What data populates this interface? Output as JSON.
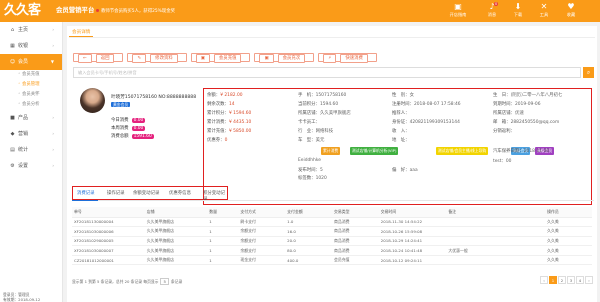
{
  "header": {
    "logo": "久久客",
    "brand": "会员营销平台",
    "notice": "教师节会员购买5人，获得25%现金奖",
    "nav": [
      {
        "label": "开店指南",
        "icon": "store-icon",
        "glyph": "▣"
      },
      {
        "label": "消息",
        "icon": "bell-icon",
        "glyph": "♪",
        "badge": "0"
      },
      {
        "label": "下载",
        "icon": "download-icon",
        "glyph": "⬇"
      },
      {
        "label": "工具",
        "icon": "tools-icon",
        "glyph": "✕"
      },
      {
        "label": "收藏",
        "icon": "heart-icon",
        "glyph": "♥"
      }
    ]
  },
  "sidebar": {
    "items": [
      {
        "label": "主页",
        "icon": "home-icon",
        "glyph": "⌂"
      },
      {
        "label": "收银",
        "icon": "cashier-icon",
        "glyph": "▦"
      },
      {
        "label": "会员",
        "icon": "member-icon",
        "glyph": "☺",
        "active": true
      }
    ],
    "subs": [
      {
        "label": "会员充值"
      },
      {
        "label": "会员管理",
        "current": true
      },
      {
        "label": "会员关怀"
      },
      {
        "label": "会员分析"
      }
    ],
    "items2": [
      {
        "label": "产品",
        "icon": "product-icon",
        "glyph": "■"
      },
      {
        "label": "营销",
        "icon": "marketing-icon",
        "glyph": "◆"
      },
      {
        "label": "统计",
        "icon": "stats-icon",
        "glyph": "▤"
      },
      {
        "label": "设置",
        "icon": "settings-icon",
        "glyph": "⚙"
      }
    ],
    "footer": {
      "user": "登录员：管理员",
      "date": "有效期：2018-09-12"
    }
  },
  "page_tab": "会员详情",
  "actions": [
    {
      "label": "返回",
      "icon": "back-icon",
      "glyph": "←"
    },
    {
      "label": "修改资料",
      "icon": "edit-icon",
      "glyph": "✎"
    },
    {
      "label": "会员充值",
      "icon": "recharge-icon",
      "glyph": "▣"
    },
    {
      "label": "会员充次",
      "icon": "recharge-count-icon",
      "glyph": "▣"
    },
    {
      "label": "快速消费",
      "icon": "quick-pay-icon",
      "glyph": "⚡"
    }
  ],
  "search": {
    "placeholder": "输入会员卡号/手机号/姓名/拼音"
  },
  "member": {
    "name": "叶晓芳15071758160",
    "no": "NO:8888888888",
    "level": "黄金会员",
    "stats": [
      {
        "label": "今日消费",
        "value": "0.00"
      },
      {
        "label": "本周消费",
        "value": "0.00"
      },
      {
        "label": "消费总额",
        "value": "1591.60"
      }
    ]
  },
  "info": [
    {
      "label": "余额：",
      "value": "¥ 2182.00",
      "red": true
    },
    {
      "label": "手　机：",
      "value": "15071758160"
    },
    {
      "label": "性　别：",
      "value": "女"
    },
    {
      "label": "生　日：",
      "value": "(阴历)二零一八年八月初七"
    },
    {
      "label": "剩余次数：",
      "value": "14",
      "red": true
    },
    {
      "label": "当前积分：",
      "value": "1594.60"
    },
    {
      "label": "注册时间：",
      "value": "2018-08-07 17:58:46"
    },
    {
      "label": "到期时间：",
      "value": "2019-09-06"
    },
    {
      "label": "累计积分：",
      "value": "¥ 1594.60",
      "red": true
    },
    {
      "label": "所属店铺：",
      "value": "久久美甲旗舰店"
    },
    {
      "label": "推荐人：",
      "value": ""
    },
    {
      "label": "所属店铺：",
      "value": "优速"
    },
    {
      "label": "累计消费：",
      "value": "¥ 4435.10",
      "red": true
    },
    {
      "label": "卡卡员工：",
      "value": ""
    },
    {
      "label": "身份证：",
      "value": "420821199309153144"
    },
    {
      "label": "邮　箱：",
      "value": "2882450550@qq.com"
    },
    {
      "label": "累计充值：",
      "value": "¥ 5850.00",
      "red": true
    },
    {
      "label": "行　业：",
      "value": "网络科技"
    },
    {
      "label": "收　入：",
      "value": ""
    },
    {
      "label": "分销返利：",
      "value": ""
    },
    {
      "label": "优惠券：",
      "value": "0",
      "red": true
    },
    {
      "label": "车　型：",
      "value": "美元"
    },
    {
      "label": "地　址：",
      "value": ""
    },
    {
      "label": "会员标签：",
      "value": ""
    },
    {
      "label": "汽车保养日期：",
      "value": "2018-11-30"
    },
    {
      "label": "",
      "value": "Eeiddhhke"
    },
    {
      "label": "",
      "value": "test：00"
    },
    {
      "label": "发布时间：",
      "value": "5"
    },
    {
      "label": "偏　好：",
      "value": "aaa"
    },
    {
      "label": "标签数：",
      "value": "1020"
    }
  ],
  "tags": [
    {
      "label": "累计消费",
      "color": "#f0a020"
    },
    {
      "label": "测试店铺/计算机分析(VIP)",
      "color": "#40b040"
    },
    {
      "label": "测试店铺/会员主播/线上导购",
      "color": "#f2d400"
    },
    {
      "label": "高级会员",
      "color": "#4aa0e0"
    },
    {
      "label": "高级会员",
      "color": "#a040c0"
    }
  ],
  "tabs": [
    "消费记录",
    "操作记录",
    "余额变动记录",
    "优惠券信息",
    "积分变动记录"
  ],
  "table": {
    "headers": [
      "单号",
      "店铺",
      "数量",
      "支付方式",
      "支付金额",
      "交易类型",
      "交易时间",
      "备注",
      "操作员"
    ],
    "rows": [
      [
        "XF20181130000004",
        "久久美甲旗舰店",
        "1",
        "刷卡支付",
        "1.0",
        "商品消费",
        "2018-11-30 14:54:22",
        "",
        "久久美"
      ],
      [
        "XF20181030000006",
        "久久美甲旗舰店",
        "1",
        "余额支付",
        "16.0",
        "商品消费",
        "2018-10-26 15:59:08",
        "",
        "久久美"
      ],
      [
        "XF20181029000005",
        "久久美甲旗舰店",
        "1",
        "余额支付",
        "20.0",
        "商品消费",
        "2018-10-29 14:24:41",
        "",
        "久久美"
      ],
      [
        "XF20181030000007",
        "久久美甲旗舰店",
        "1",
        "余额支付",
        "80.0",
        "商品消费",
        "2018-10-24 10:41:48",
        "大优惠一般",
        "久久美"
      ],
      [
        "CZ20181012000001",
        "久久美甲旗舰店",
        "1",
        "现金支付",
        "400.0",
        "会员充值",
        "2018-10-12 09:24:11",
        "",
        "久久美"
      ]
    ]
  },
  "pager": {
    "text": "显示第 1 到第 5 条记录，总共 20 条记录 每页显示",
    "size": "5",
    "suffix": "条记录",
    "pages": [
      "‹",
      "1",
      "2",
      "3",
      "4",
      "›"
    ],
    "current": "1"
  }
}
